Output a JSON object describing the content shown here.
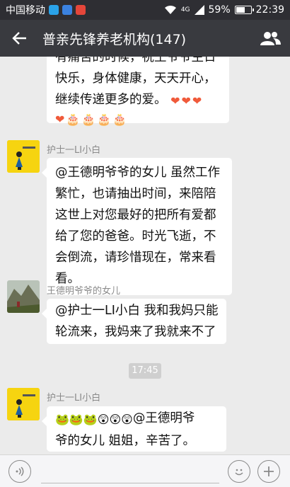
{
  "status_bar": {
    "carrier": "中国移动",
    "network": "4G",
    "battery_percent": "59%",
    "battery_level": 0.59,
    "time": "22:39"
  },
  "header": {
    "title": "普亲先锋养老机构(147)",
    "back_icon": "arrow-left-icon",
    "members_icon": "group-members-icon"
  },
  "messages": [
    {
      "sender": "",
      "lines": [
        "有痛苦的时候，祝王爷爷生日",
        "快乐，身体健康，天天开心，",
        "继续传递更多的爱。"
      ],
      "emoji_tail": [
        "❤",
        "❤",
        "❤"
      ],
      "emoji_line": [
        "❤",
        "🎂",
        "🎂",
        "🎂",
        "🎂"
      ]
    },
    {
      "sender": "护士一LI小白",
      "lines": [
        "@王德明爷爷的女儿 虽然工作",
        "繁忙，也请抽出时间，来陪陪",
        "这世上对您最好的把所有爱都",
        "给了您的爸爸。时光飞逝，不",
        "会倒流，请珍惜现在，常来看",
        "看。"
      ]
    },
    {
      "sender": "王德明爷爷的女儿",
      "lines": [
        "@护士一LI小白 我和我妈只能",
        "轮流来，我妈来了我就来不了"
      ]
    },
    {
      "timestamp": "17:45"
    },
    {
      "sender": "护士一LI小白",
      "emoji_prefix": [
        "🐸",
        "🐸",
        "🐸",
        "😲",
        "😲",
        "😲"
      ],
      "lines": [
        "@王德明爷",
        "爷的女儿 姐姐，辛苦了。"
      ]
    }
  ],
  "input": {
    "value": "",
    "voice_icon": "voice-icon",
    "emoji_icon": "emoji-face-icon",
    "plus_icon": "plus-icon"
  },
  "colors": {
    "status_bar": "#2e2e33",
    "header": "#393a3f",
    "chat_bg": "#ebebeb",
    "bubble": "#ffffff",
    "heart": "#f05a3a",
    "avatar_yellow": "#f6d410"
  }
}
